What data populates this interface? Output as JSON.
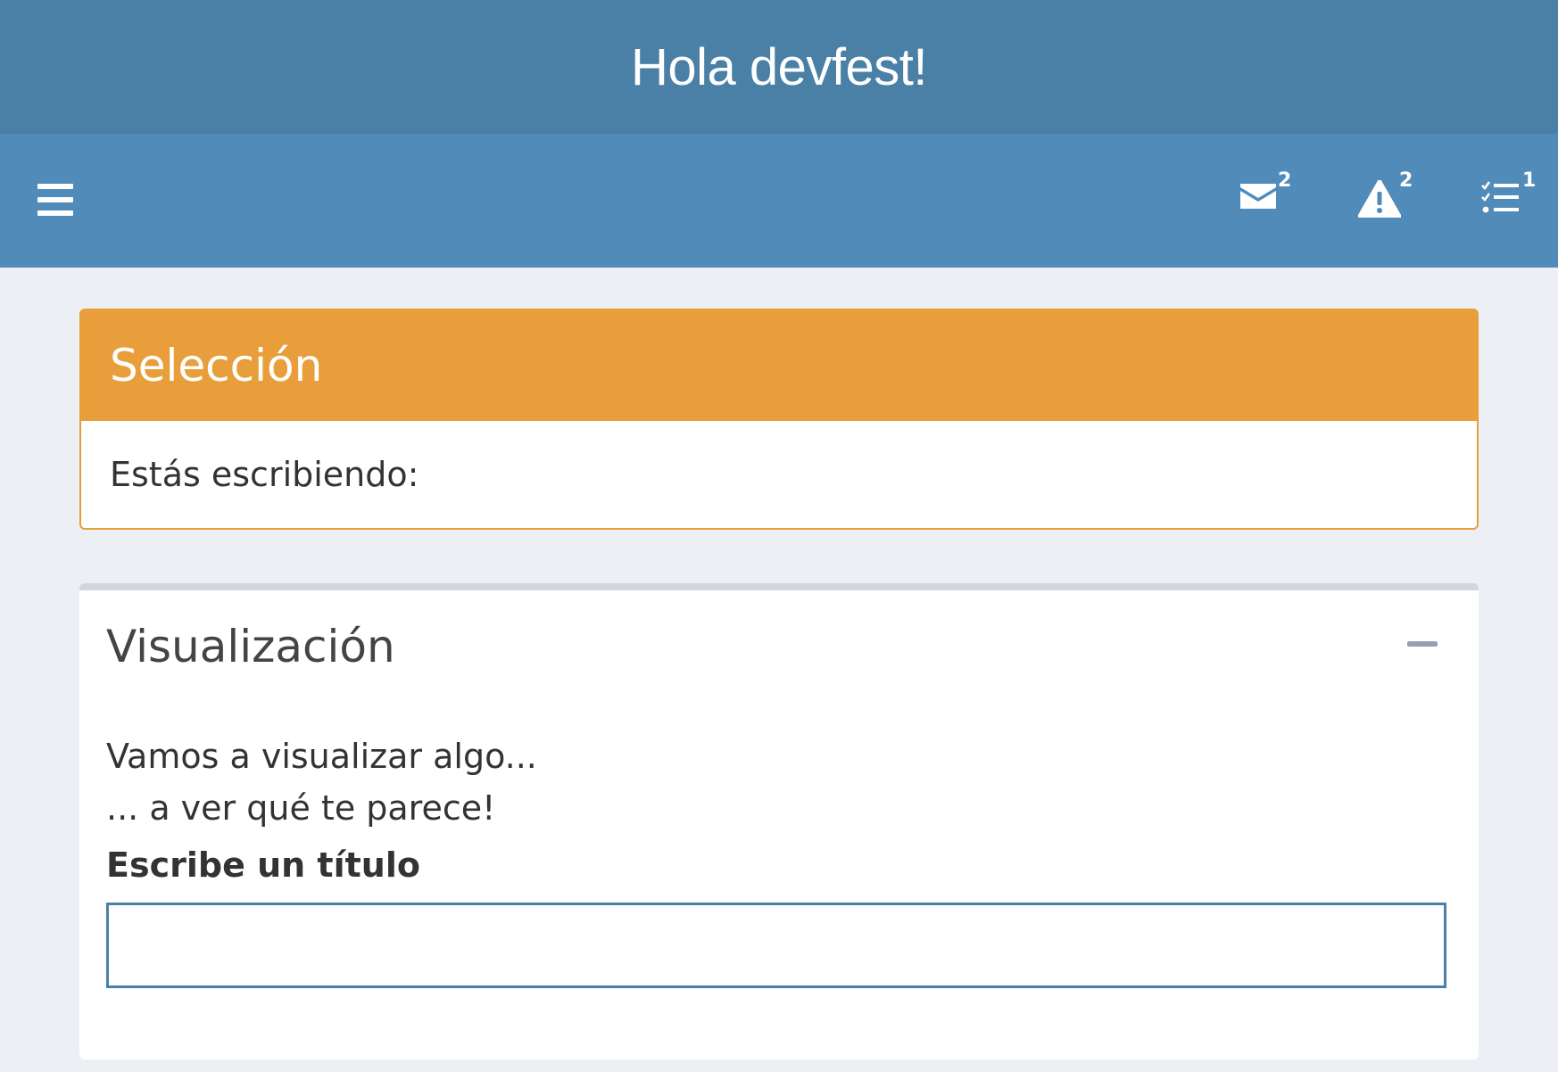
{
  "app": {
    "title": "Hola devfest!"
  },
  "navbar": {
    "messages": {
      "icon": "envelope-icon",
      "count": "2"
    },
    "notifications": {
      "icon": "warning-icon",
      "count": "2"
    },
    "tasks": {
      "icon": "tasks-icon",
      "count": "1"
    }
  },
  "selection_box": {
    "title": "Selección",
    "body": "Estás escribiendo:"
  },
  "visualization_box": {
    "title": "Visualización",
    "line1": "Vamos a visualizar algo...",
    "line2": "... a ver qué te parece!",
    "input_label": "Escribe un título",
    "input_value": ""
  },
  "colors": {
    "header_bg": "#4a7fa6",
    "navbar_bg": "#508bba",
    "warning": "#e89f3b",
    "page_bg": "#ecf0f5"
  }
}
